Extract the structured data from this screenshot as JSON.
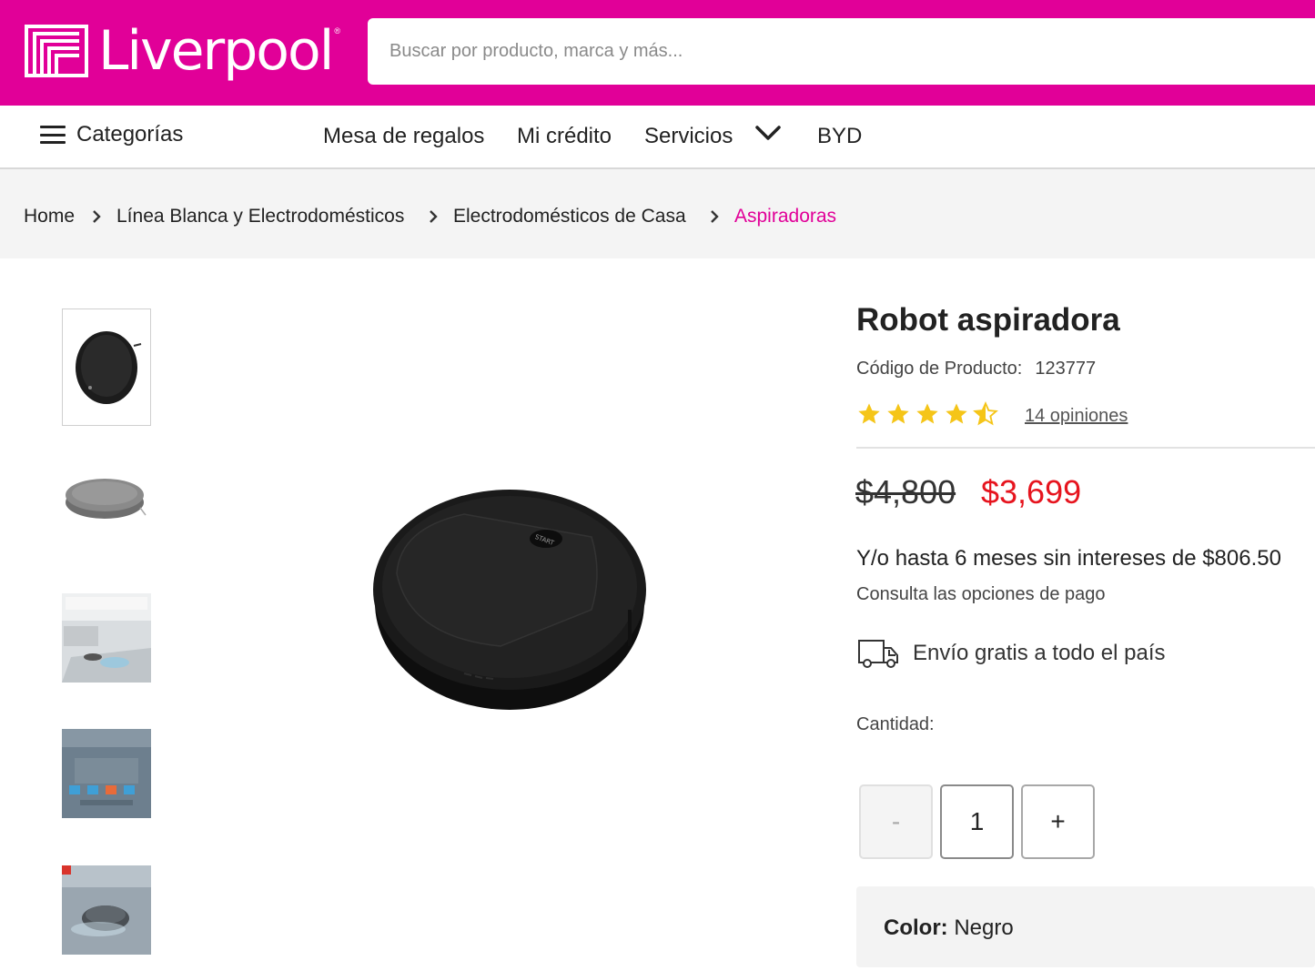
{
  "header": {
    "logo_text": "Liverpool",
    "search_placeholder": "Buscar por producto, marca y más...",
    "brand_color": "#e10098"
  },
  "nav": {
    "categories_label": "Categorías",
    "links": [
      "Mesa de regalos",
      "Mi crédito",
      "Servicios",
      "BYD"
    ]
  },
  "breadcrumb": {
    "items": [
      "Home",
      "Línea Blanca y Electrodomésticos",
      "Electrodomésticos de Casa",
      "Aspiradoras"
    ]
  },
  "gallery": {
    "thumbnail_count": 5,
    "selected_index": 0,
    "main_image": "robot-vacuum-black",
    "start_label": "START"
  },
  "product": {
    "title": "Robot aspiradora",
    "code_label": "Código de Producto:",
    "code_value": "123777",
    "rating": 4.5,
    "rating_max": 5,
    "reviews_label": "14 opiniones",
    "old_price": "$4,800",
    "new_price": "$3,699",
    "installments": "Y/o hasta 6 meses sin intereses de $806.50",
    "payment_options": "Consulta las opciones de pago",
    "shipping": "Envío gratis a todo el país",
    "quantity_label": "Cantidad:",
    "quantity_minus": "-",
    "quantity_value": "1",
    "quantity_plus": "+",
    "color_label": "Color:",
    "color_value": "Negro",
    "price_color": "#e6141e",
    "star_color": "#f5c518"
  }
}
